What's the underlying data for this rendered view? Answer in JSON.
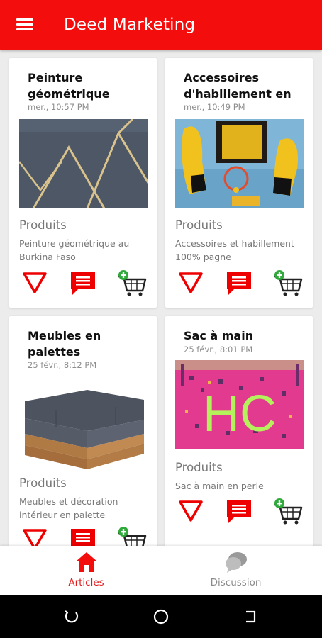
{
  "app": {
    "title": "Deed Marketing",
    "accent": "#f40d0d"
  },
  "articles": [
    {
      "title": "Peinture géométrique",
      "date": "mer., 10:57 PM",
      "category": "Produits",
      "description": "Peinture géométrique au Burkina Faso"
    },
    {
      "title": "Accessoires d'habillement en",
      "date": "mer., 10:49 PM",
      "category": "Produits",
      "description": "Accessoires et habillement 100% pagne"
    },
    {
      "title": "Meubles en palettes",
      "date": "25 févr., 8:12 PM",
      "category": "Produits",
      "description": "Meubles et décoration intérieur en palette"
    },
    {
      "title": "Sac à main",
      "date": "25 févr., 8:01 PM",
      "category": "Produits",
      "description": "Sac à main en perle",
      "image_text": "HC"
    }
  ],
  "actions": {
    "icons": [
      "down-triangle-icon",
      "comment-icon",
      "add-to-cart-icon"
    ]
  },
  "bottom_nav": {
    "items": [
      {
        "label": "Articles",
        "icon": "home-icon",
        "active": true
      },
      {
        "label": "Discussion",
        "icon": "chat-icon",
        "active": false
      }
    ]
  },
  "system_nav": {
    "icons": [
      "recent-apps-icon",
      "home-circle-icon",
      "back-icon"
    ]
  }
}
